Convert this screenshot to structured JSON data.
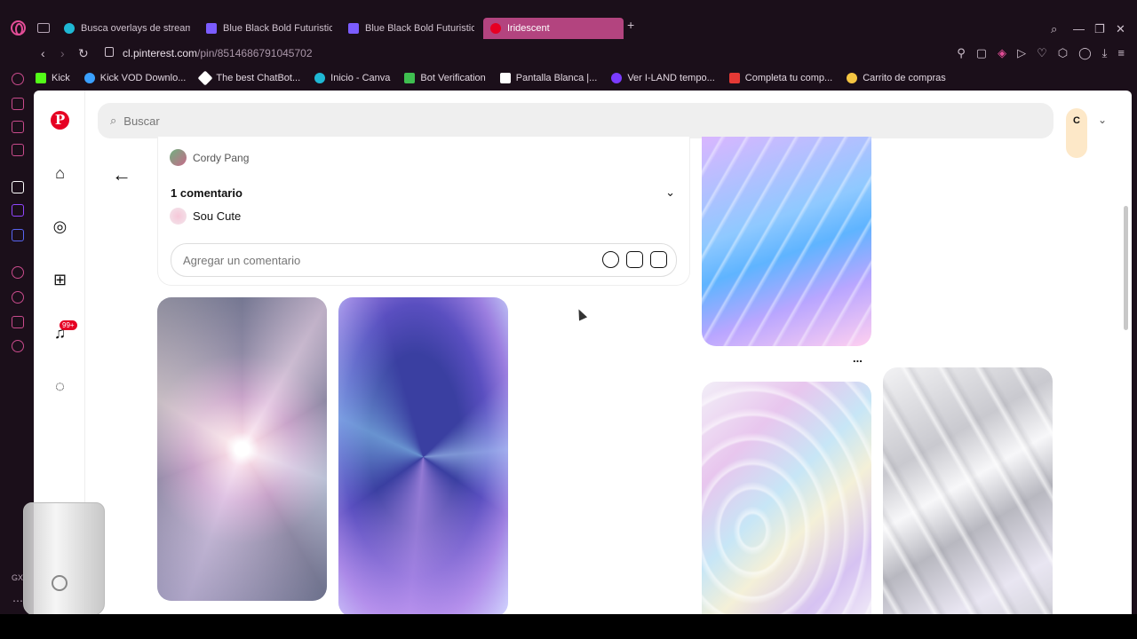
{
  "browser": {
    "tabs": [
      {
        "label": "Busca overlays de stream",
        "icon": "canva"
      },
      {
        "label": "Blue Black Bold Futuristic",
        "icon": "video"
      },
      {
        "label": "Blue Black Bold Futuristic",
        "icon": "video"
      },
      {
        "label": "Iridescent",
        "icon": "pin",
        "active": true
      }
    ],
    "url_host": "cl.pinterest.com",
    "url_path": "/pin/8514686791045702",
    "bookmarks": [
      {
        "label": "Kick",
        "color": "#53fc18"
      },
      {
        "label": "Kick VOD Downlo...",
        "color": "#3aa0ff"
      },
      {
        "label": "The best ChatBot...",
        "color": "#ffffff"
      },
      {
        "label": "Inicio - Canva",
        "color": "#1fb8d4"
      },
      {
        "label": "Bot Verification",
        "color": "#3fbf50"
      },
      {
        "label": "Pantalla Blanca |...",
        "color": "#ffffff"
      },
      {
        "label": "Ver I-LAND tempo...",
        "color": "#7a3bff"
      },
      {
        "label": "Completa tu comp...",
        "color": "#e53935"
      },
      {
        "label": "Carrito de compras",
        "color": "#f5c542"
      }
    ]
  },
  "pinterest": {
    "search_placeholder": "Buscar",
    "account_initial": "C",
    "notifications_badge": "99+",
    "author_name": "Cordy Pang",
    "comments_header": "1 comentario",
    "commenter_name": "Sou Cute",
    "add_comment_placeholder": "Agregar un comentario",
    "more_label": "...",
    "gx_label": "GX"
  }
}
